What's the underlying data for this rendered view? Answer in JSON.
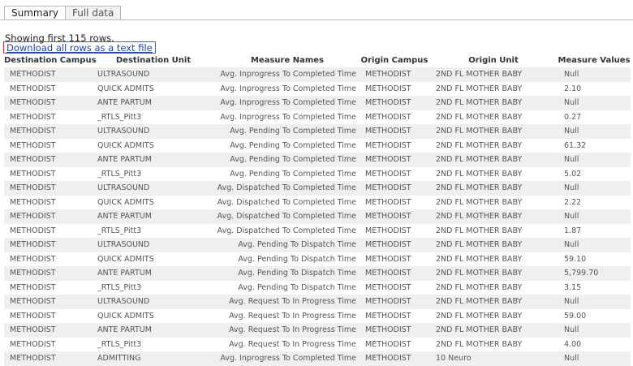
{
  "tabs": [
    {
      "label": "Summary",
      "active": true
    },
    {
      "label": "Full data",
      "active": false
    }
  ],
  "status_text": "Showing first 115 rows.",
  "download_link": "Download all rows as a text file",
  "table": {
    "columns": [
      "Destination Campus",
      "Destination Unit",
      "Measure Names",
      "Origin Campus",
      "Origin Unit",
      "Measure Values"
    ],
    "rows": [
      [
        "METHODIST",
        "ULTRASOUND",
        "Avg. Inprogress To Completed Time",
        "METHODIST",
        "2ND FL MOTHER BABY",
        "Null"
      ],
      [
        "METHODIST",
        "QUICK ADMITS",
        "Avg. Inprogress To Completed Time",
        "METHODIST",
        "2ND FL MOTHER BABY",
        "2.10"
      ],
      [
        "METHODIST",
        "ANTE PARTUM",
        "Avg. Inprogress To Completed Time",
        "METHODIST",
        "2ND FL MOTHER BABY",
        "Null"
      ],
      [
        "METHODIST",
        "_RTLS_Pitt3",
        "Avg. Inprogress To Completed Time",
        "METHODIST",
        "2ND FL MOTHER BABY",
        "0.27"
      ],
      [
        "METHODIST",
        "ULTRASOUND",
        "Avg. Pending To Completed Time",
        "METHODIST",
        "2ND FL MOTHER BABY",
        "Null"
      ],
      [
        "METHODIST",
        "QUICK ADMITS",
        "Avg. Pending To Completed Time",
        "METHODIST",
        "2ND FL MOTHER BABY",
        "61.32"
      ],
      [
        "METHODIST",
        "ANTE PARTUM",
        "Avg. Pending To Completed Time",
        "METHODIST",
        "2ND FL MOTHER BABY",
        "Null"
      ],
      [
        "METHODIST",
        "_RTLS_Pitt3",
        "Avg. Pending To Completed Time",
        "METHODIST",
        "2ND FL MOTHER BABY",
        "5.02"
      ],
      [
        "METHODIST",
        "ULTRASOUND",
        "Avg. Dispatched To Completed Time",
        "METHODIST",
        "2ND FL MOTHER BABY",
        "Null"
      ],
      [
        "METHODIST",
        "QUICK ADMITS",
        "Avg. Dispatched To Completed Time",
        "METHODIST",
        "2ND FL MOTHER BABY",
        "2.22"
      ],
      [
        "METHODIST",
        "ANTE PARTUM",
        "Avg. Dispatched To Completed Time",
        "METHODIST",
        "2ND FL MOTHER BABY",
        "Null"
      ],
      [
        "METHODIST",
        "_RTLS_Pitt3",
        "Avg. Dispatched To Completed Time",
        "METHODIST",
        "2ND FL MOTHER BABY",
        "1.87"
      ],
      [
        "METHODIST",
        "ULTRASOUND",
        "Avg. Pending To Dispatch Time",
        "METHODIST",
        "2ND FL MOTHER BABY",
        "Null"
      ],
      [
        "METHODIST",
        "QUICK ADMITS",
        "Avg. Pending To Dispatch Time",
        "METHODIST",
        "2ND FL MOTHER BABY",
        "59.10"
      ],
      [
        "METHODIST",
        "ANTE PARTUM",
        "Avg. Pending To Dispatch Time",
        "METHODIST",
        "2ND FL MOTHER BABY",
        "5,799.70"
      ],
      [
        "METHODIST",
        "_RTLS_Pitt3",
        "Avg. Pending To Dispatch Time",
        "METHODIST",
        "2ND FL MOTHER BABY",
        "3.15"
      ],
      [
        "METHODIST",
        "ULTRASOUND",
        "Avg. Request To In Progress Time",
        "METHODIST",
        "2ND FL MOTHER BABY",
        "Null"
      ],
      [
        "METHODIST",
        "QUICK ADMITS",
        "Avg. Request To In Progress Time",
        "METHODIST",
        "2ND FL MOTHER BABY",
        "59.00"
      ],
      [
        "METHODIST",
        "ANTE PARTUM",
        "Avg. Request To In Progress Time",
        "METHODIST",
        "2ND FL MOTHER BABY",
        "Null"
      ],
      [
        "METHODIST",
        "_RTLS_Pitt3",
        "Avg. Request To In Progress Time",
        "METHODIST",
        "2ND FL MOTHER BABY",
        "4.00"
      ],
      [
        "METHODIST",
        "ADMITTING",
        "Avg. Inprogress To Completed Time",
        "METHODIST",
        "10 Neuro",
        "Null"
      ]
    ]
  }
}
